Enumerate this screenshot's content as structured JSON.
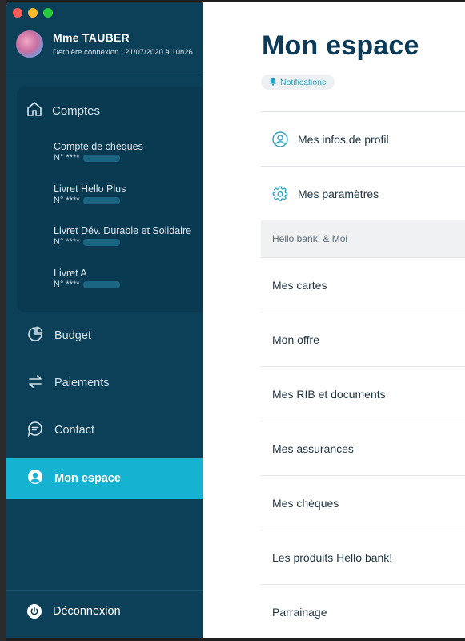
{
  "window": {
    "traffic_lights": [
      "close",
      "minimize",
      "zoom"
    ]
  },
  "profile": {
    "name": "Mme TAUBER",
    "last_login": "Dernière connexion : 21/07/2020 à 10h26"
  },
  "sidebar": {
    "accounts_label": "Comptes",
    "accounts": [
      {
        "name": "Compte de chèques",
        "number": "N° ****"
      },
      {
        "name": "Livret Hello Plus",
        "number": "N° ****"
      },
      {
        "name": "Livret Dév. Durable et Solidaire",
        "number": "N° ****"
      },
      {
        "name": "Livret A",
        "number": "N° ****"
      }
    ],
    "items": [
      {
        "label": "Budget",
        "icon": "pie-chart-icon"
      },
      {
        "label": "Paiements",
        "icon": "transfer-arrows-icon"
      },
      {
        "label": "Contact",
        "icon": "chat-bubble-icon"
      },
      {
        "label": "Mon espace",
        "icon": "user-circle-icon",
        "active": true
      }
    ],
    "logout_label": "Déconnexion"
  },
  "main": {
    "title": "Mon espace",
    "notifications_label": "Notifications",
    "profile_rows": [
      {
        "label": "Mes infos de profil",
        "icon": "user-profile-icon"
      },
      {
        "label": "Mes paramètres",
        "icon": "gear-icon"
      }
    ],
    "section_label": "Hello bank! & Moi",
    "menu_rows": [
      "Mes cartes",
      "Mon offre",
      "Mes RIB et documents",
      "Mes assurances",
      "Mes chèques",
      "Les produits Hello bank!",
      "Parrainage"
    ]
  },
  "colors": {
    "sidebar_bg": "#0c4059",
    "active_item": "#15b2d2",
    "title": "#0b3b58",
    "accent": "#2aa4c4"
  }
}
